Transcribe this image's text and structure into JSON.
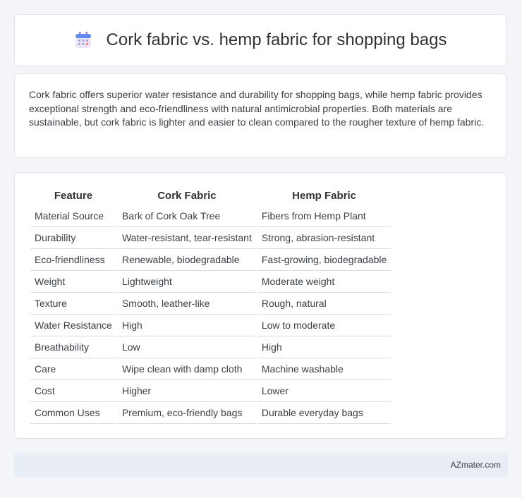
{
  "header": {
    "title": "Cork fabric vs. hemp fabric for shopping bags",
    "icon": "calendar-icon"
  },
  "summary": {
    "text": "Cork fabric offers superior water resistance and durability for shopping bags, while hemp fabric provides exceptional strength and eco-friendliness with natural antimicrobial properties. Both materials are sustainable, but cork fabric is lighter and easier to clean compared to the rougher texture of hemp fabric."
  },
  "table": {
    "headers": [
      "Feature",
      "Cork Fabric",
      "Hemp Fabric"
    ],
    "rows": [
      [
        "Material Source",
        "Bark of Cork Oak Tree",
        "Fibers from Hemp Plant"
      ],
      [
        "Durability",
        "Water-resistant, tear-resistant",
        "Strong, abrasion-resistant"
      ],
      [
        "Eco-friendliness",
        "Renewable, biodegradable",
        "Fast-growing, biodegradable"
      ],
      [
        "Weight",
        "Lightweight",
        "Moderate weight"
      ],
      [
        "Texture",
        "Smooth, leather-like",
        "Rough, natural"
      ],
      [
        "Water Resistance",
        "High",
        "Low to moderate"
      ],
      [
        "Breathability",
        "Low",
        "High"
      ],
      [
        "Care",
        "Wipe clean with damp cloth",
        "Machine washable"
      ],
      [
        "Cost",
        "Higher",
        "Lower"
      ],
      [
        "Common Uses",
        "Premium, eco-friendly bags",
        "Durable everyday bags"
      ]
    ]
  },
  "footer": {
    "site": "AZmater.com"
  }
}
